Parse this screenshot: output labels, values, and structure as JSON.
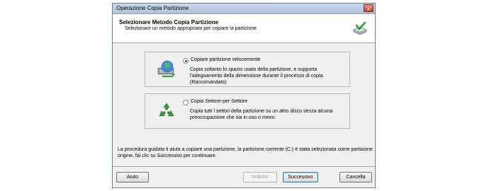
{
  "window": {
    "title": "Operazione Copia Partizione",
    "close_label": "x"
  },
  "header": {
    "title": "Selezionare Metodo Copia Partizione",
    "subtitle": "Selezionare un metodo appropriato per copiare la partizione",
    "icon": "disk-checkmark-icon"
  },
  "options": [
    {
      "label": "Copiare partizione velocemente",
      "description": "Copia soltanto lo spazio usato della partizione, e supporta l'adeguamento della dimensione durante il processo di copia.(Raccomandato)",
      "selected": true,
      "icon": "fast-copy-globe-icon"
    },
    {
      "label": "Copia Settore-per-Settore",
      "description": "Copia tutti i settori della partizione su un altro disco senza alcuna preoccupazione che sia in uso o meno.",
      "selected": false,
      "icon": "recycle-icon"
    }
  ],
  "info_text": "La procedura guidata ti aiuta a copiare una partizione, la partizione corrente (C:) è stata selezionata come partizione origine, fai clic su Successivo per continuare.",
  "buttons": {
    "help": "Aiuto",
    "back": "Indietro",
    "next": "Successivo",
    "cancel": "Cancella"
  },
  "colors": {
    "accent": "#1c4e9a",
    "recycle_green": "#3a9a3a"
  }
}
